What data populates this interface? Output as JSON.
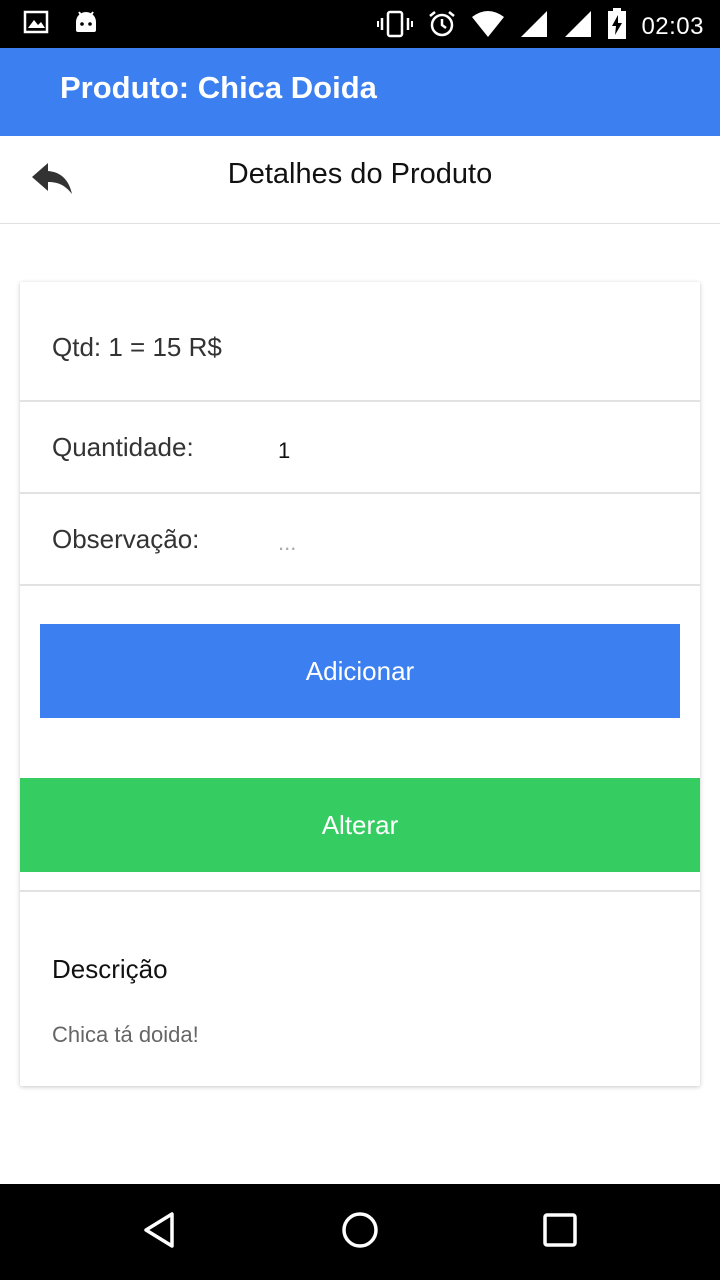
{
  "statusbar": {
    "time": "02:03",
    "icons": [
      "image-icon",
      "android-icon",
      "vibrate-icon",
      "alarm-icon",
      "wifi-icon",
      "signal-icon",
      "signal-icon",
      "battery-charging-icon"
    ]
  },
  "appbar": {
    "title": "Produto: Chica Doida",
    "color": "#3b7ff0"
  },
  "subheader": {
    "back_icon": "reply-arrow-icon",
    "title": "Detalhes do Produto"
  },
  "card": {
    "price_line": "Qtd: 1 = 15 R$",
    "quantity": {
      "label": "Quantidade:",
      "value": "1"
    },
    "observation": {
      "label": "Observação:",
      "placeholder": "..."
    },
    "add_button": "Adicionar",
    "alter_button": "Alterar",
    "description": {
      "title": "Descrição",
      "text": "Chica tá doida!"
    }
  },
  "colors": {
    "primary": "#3b7ff0",
    "success": "#35cc62"
  },
  "navbar": {
    "icons": [
      "back-triangle-icon",
      "home-circle-icon",
      "recents-square-icon"
    ]
  }
}
